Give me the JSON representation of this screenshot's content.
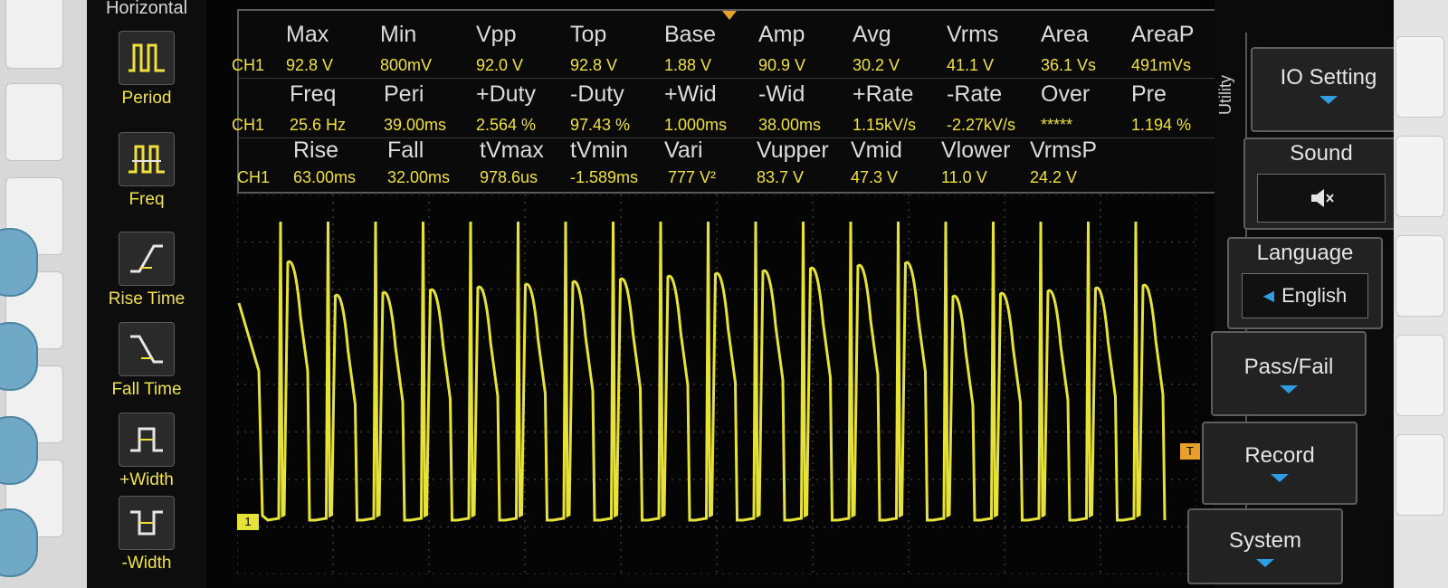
{
  "horizontal_menu": {
    "title": "Horizontal",
    "items": [
      {
        "label": "Period",
        "icon": "period-pulse-icon"
      },
      {
        "label": "Freq",
        "icon": "frequency-pulse-icon"
      },
      {
        "label": "Rise Time",
        "icon": "rise-time-icon"
      },
      {
        "label": "Fall Time",
        "icon": "fall-time-icon"
      },
      {
        "label": "+Width",
        "icon": "positive-width-icon"
      },
      {
        "label": "-Width",
        "icon": "negative-width-icon"
      }
    ]
  },
  "measurements": {
    "channel": "CH1",
    "rows": [
      {
        "headers": [
          "Max",
          "Min",
          "Vpp",
          "Top",
          "Base",
          "Amp",
          "Avg",
          "Vrms",
          "Area",
          "AreaP"
        ],
        "values": [
          "92.8 V",
          "800mV",
          "92.0 V",
          "92.8 V",
          "1.88 V",
          "90.9 V",
          "30.2 V",
          "41.1 V",
          "36.1 Vs",
          "491mVs"
        ]
      },
      {
        "headers": [
          "Freq",
          "Peri",
          "+Duty",
          "-Duty",
          "+Wid",
          "-Wid",
          "+Rate",
          "-Rate",
          "Over",
          "Pre"
        ],
        "values": [
          "25.6 Hz",
          "39.00ms",
          "2.564 %",
          "97.43 %",
          "1.000ms",
          "38.00ms",
          "1.15kV/s",
          "-2.27kV/s",
          "*****",
          "1.194 %"
        ]
      },
      {
        "headers": [
          "Rise",
          "Fall",
          "tVmax",
          "tVmin",
          "Vari",
          "Vupper",
          "Vmid",
          "Vlower",
          "VrmsP"
        ],
        "values": [
          "63.00ms",
          "32.00ms",
          "978.6us",
          "-1.589ms",
          "777 V²",
          "83.7 V",
          "47.3 V",
          "11.0 V",
          "24.2 V"
        ]
      }
    ]
  },
  "utility_menu": {
    "side_label": "Utility",
    "items": [
      {
        "label": "IO Setting"
      },
      {
        "label": "Sound",
        "icon": "speaker-muted-icon"
      },
      {
        "label": "Language",
        "value": "English"
      },
      {
        "label": "Pass/Fail"
      },
      {
        "label": "Record"
      },
      {
        "label": "System"
      }
    ]
  },
  "markers": {
    "ground": "1",
    "trigger": "T"
  },
  "colors": {
    "trace": "#e6e23a",
    "grid": "#3c3c3c",
    "accent": "#2f9de2",
    "text_yellow": "#f0e040"
  }
}
